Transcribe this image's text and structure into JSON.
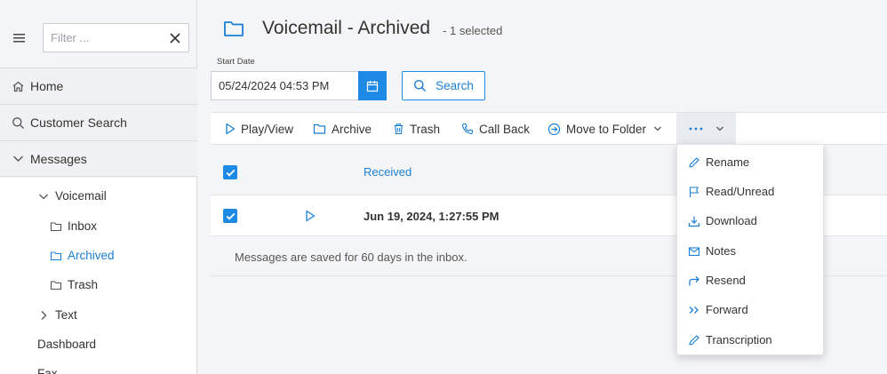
{
  "sidebar": {
    "filter_placeholder": "Filter ...",
    "nav": [
      {
        "label": "Home",
        "icon": "home-icon"
      },
      {
        "label": "Customer Search",
        "icon": "search-icon"
      },
      {
        "label": "Messages",
        "icon": "chevron-down-icon"
      }
    ],
    "voicemail_label": "Voicemail",
    "folders": [
      "Inbox",
      "Archived",
      "Trash"
    ],
    "active_folder": "Archived",
    "text_label": "Text",
    "dashboard_label": "Dashboard",
    "fax_label": "Fax"
  },
  "header": {
    "title": "Voicemail - Archived",
    "selected": "- 1 selected"
  },
  "filters": {
    "start_date_label": "Start Date",
    "start_date_value": "05/24/2024 04:53 PM",
    "search_label": "Search"
  },
  "toolbar": {
    "play": "Play/View",
    "archive": "Archive",
    "trash": "Trash",
    "callback": "Call Back",
    "move": "Move to Folder"
  },
  "table": {
    "column_received": "Received",
    "rows": [
      {
        "received": "Jun 19, 2024, 1:27:55 PM",
        "checked": true
      }
    ],
    "footer_message": "Messages are saved for 60 days in the inbox."
  },
  "more_menu": {
    "items": [
      "Rename",
      "Read/Unread",
      "Download",
      "Notes",
      "Resend",
      "Forward",
      "Transcription"
    ]
  },
  "colors": {
    "accent": "#1f8ae6",
    "link": "#1a7fd4"
  }
}
